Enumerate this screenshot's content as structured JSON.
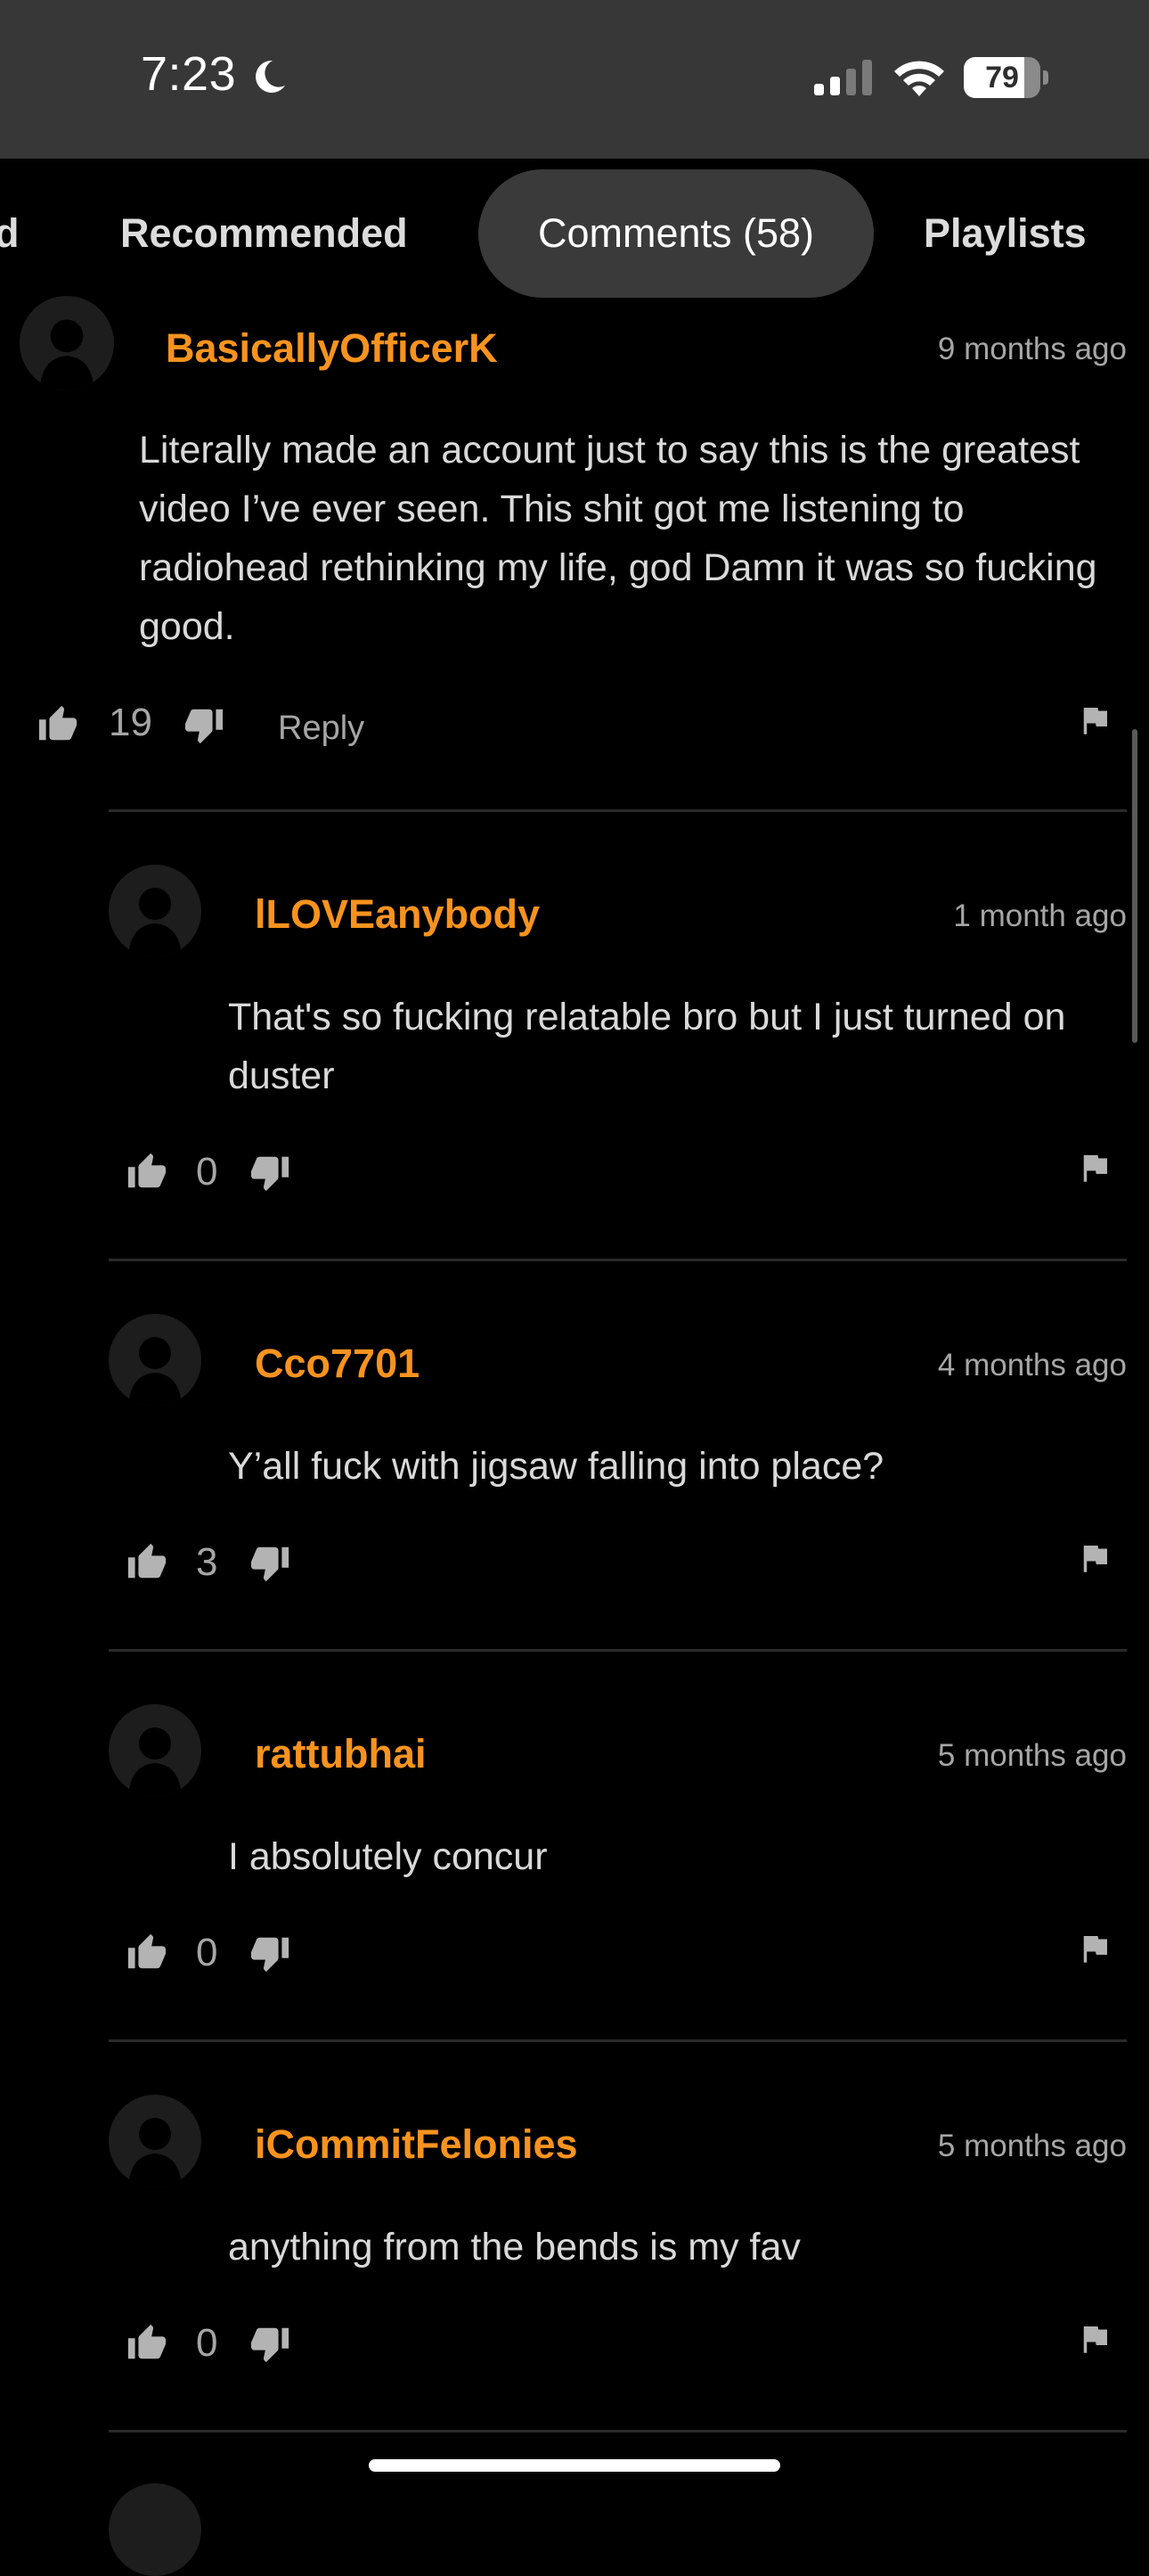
{
  "status_bar": {
    "time": "7:23",
    "battery_level": 79,
    "battery_label": "79",
    "icons": [
      "moon-icon",
      "signal-icon",
      "wifi-icon",
      "battery-icon"
    ]
  },
  "tabs": {
    "partial": "d",
    "recommended": "Recommended",
    "comments": "Comments (58)",
    "playlists": "Playlists",
    "active": "comments"
  },
  "comments": [
    {
      "username": "BasicallyOfficerK",
      "time": "9 months ago",
      "text": "Literally made an account just to say this is the greatest video I’ve ever seen. This shit got me listening to radiohead rethinking my life, god Damn it was so fucking good.",
      "likes": "19",
      "reply_label": "Reply"
    },
    {
      "username": "lLOVEanybody",
      "time": "1 month ago",
      "text": "That's so fucking relatable bro but I just turned on duster",
      "likes": "0"
    },
    {
      "username": "Cco7701",
      "time": "4 months ago",
      "text": "Y’all fuck with jigsaw falling into place?",
      "likes": "3"
    },
    {
      "username": "rattubhai",
      "time": "5 months ago",
      "text": "I absolutely concur",
      "likes": "0"
    },
    {
      "username": "iCommitFelonies",
      "time": "5 months ago",
      "text": "anything from the bends is my fav",
      "likes": "0"
    }
  ],
  "colors": {
    "background": "#000000",
    "status_bar": "#373737",
    "username": "#f7931e",
    "active_tab": "#3a3a3a",
    "divider": "#2a2a2a"
  }
}
